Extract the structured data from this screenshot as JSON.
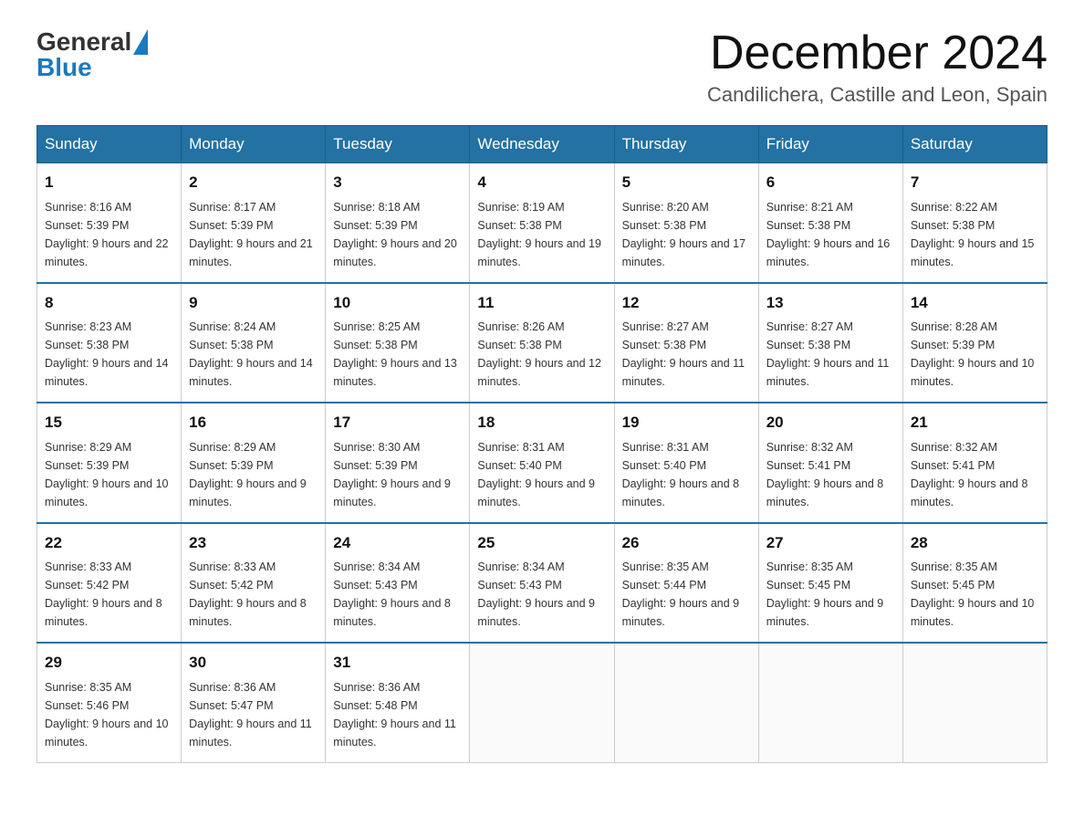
{
  "logo": {
    "general": "General",
    "blue": "Blue"
  },
  "header": {
    "month": "December 2024",
    "location": "Candilichera, Castille and Leon, Spain"
  },
  "weekdays": [
    "Sunday",
    "Monday",
    "Tuesday",
    "Wednesday",
    "Thursday",
    "Friday",
    "Saturday"
  ],
  "weeks": [
    [
      {
        "day": "1",
        "sunrise": "8:16 AM",
        "sunset": "5:39 PM",
        "daylight": "9 hours and 22 minutes."
      },
      {
        "day": "2",
        "sunrise": "8:17 AM",
        "sunset": "5:39 PM",
        "daylight": "9 hours and 21 minutes."
      },
      {
        "day": "3",
        "sunrise": "8:18 AM",
        "sunset": "5:39 PM",
        "daylight": "9 hours and 20 minutes."
      },
      {
        "day": "4",
        "sunrise": "8:19 AM",
        "sunset": "5:38 PM",
        "daylight": "9 hours and 19 minutes."
      },
      {
        "day": "5",
        "sunrise": "8:20 AM",
        "sunset": "5:38 PM",
        "daylight": "9 hours and 17 minutes."
      },
      {
        "day": "6",
        "sunrise": "8:21 AM",
        "sunset": "5:38 PM",
        "daylight": "9 hours and 16 minutes."
      },
      {
        "day": "7",
        "sunrise": "8:22 AM",
        "sunset": "5:38 PM",
        "daylight": "9 hours and 15 minutes."
      }
    ],
    [
      {
        "day": "8",
        "sunrise": "8:23 AM",
        "sunset": "5:38 PM",
        "daylight": "9 hours and 14 minutes."
      },
      {
        "day": "9",
        "sunrise": "8:24 AM",
        "sunset": "5:38 PM",
        "daylight": "9 hours and 14 minutes."
      },
      {
        "day": "10",
        "sunrise": "8:25 AM",
        "sunset": "5:38 PM",
        "daylight": "9 hours and 13 minutes."
      },
      {
        "day": "11",
        "sunrise": "8:26 AM",
        "sunset": "5:38 PM",
        "daylight": "9 hours and 12 minutes."
      },
      {
        "day": "12",
        "sunrise": "8:27 AM",
        "sunset": "5:38 PM",
        "daylight": "9 hours and 11 minutes."
      },
      {
        "day": "13",
        "sunrise": "8:27 AM",
        "sunset": "5:38 PM",
        "daylight": "9 hours and 11 minutes."
      },
      {
        "day": "14",
        "sunrise": "8:28 AM",
        "sunset": "5:39 PM",
        "daylight": "9 hours and 10 minutes."
      }
    ],
    [
      {
        "day": "15",
        "sunrise": "8:29 AM",
        "sunset": "5:39 PM",
        "daylight": "9 hours and 10 minutes."
      },
      {
        "day": "16",
        "sunrise": "8:29 AM",
        "sunset": "5:39 PM",
        "daylight": "9 hours and 9 minutes."
      },
      {
        "day": "17",
        "sunrise": "8:30 AM",
        "sunset": "5:39 PM",
        "daylight": "9 hours and 9 minutes."
      },
      {
        "day": "18",
        "sunrise": "8:31 AM",
        "sunset": "5:40 PM",
        "daylight": "9 hours and 9 minutes."
      },
      {
        "day": "19",
        "sunrise": "8:31 AM",
        "sunset": "5:40 PM",
        "daylight": "9 hours and 8 minutes."
      },
      {
        "day": "20",
        "sunrise": "8:32 AM",
        "sunset": "5:41 PM",
        "daylight": "9 hours and 8 minutes."
      },
      {
        "day": "21",
        "sunrise": "8:32 AM",
        "sunset": "5:41 PM",
        "daylight": "9 hours and 8 minutes."
      }
    ],
    [
      {
        "day": "22",
        "sunrise": "8:33 AM",
        "sunset": "5:42 PM",
        "daylight": "9 hours and 8 minutes."
      },
      {
        "day": "23",
        "sunrise": "8:33 AM",
        "sunset": "5:42 PM",
        "daylight": "9 hours and 8 minutes."
      },
      {
        "day": "24",
        "sunrise": "8:34 AM",
        "sunset": "5:43 PM",
        "daylight": "9 hours and 8 minutes."
      },
      {
        "day": "25",
        "sunrise": "8:34 AM",
        "sunset": "5:43 PM",
        "daylight": "9 hours and 9 minutes."
      },
      {
        "day": "26",
        "sunrise": "8:35 AM",
        "sunset": "5:44 PM",
        "daylight": "9 hours and 9 minutes."
      },
      {
        "day": "27",
        "sunrise": "8:35 AM",
        "sunset": "5:45 PM",
        "daylight": "9 hours and 9 minutes."
      },
      {
        "day": "28",
        "sunrise": "8:35 AM",
        "sunset": "5:45 PM",
        "daylight": "9 hours and 10 minutes."
      }
    ],
    [
      {
        "day": "29",
        "sunrise": "8:35 AM",
        "sunset": "5:46 PM",
        "daylight": "9 hours and 10 minutes."
      },
      {
        "day": "30",
        "sunrise": "8:36 AM",
        "sunset": "5:47 PM",
        "daylight": "9 hours and 11 minutes."
      },
      {
        "day": "31",
        "sunrise": "8:36 AM",
        "sunset": "5:48 PM",
        "daylight": "9 hours and 11 minutes."
      },
      null,
      null,
      null,
      null
    ]
  ]
}
